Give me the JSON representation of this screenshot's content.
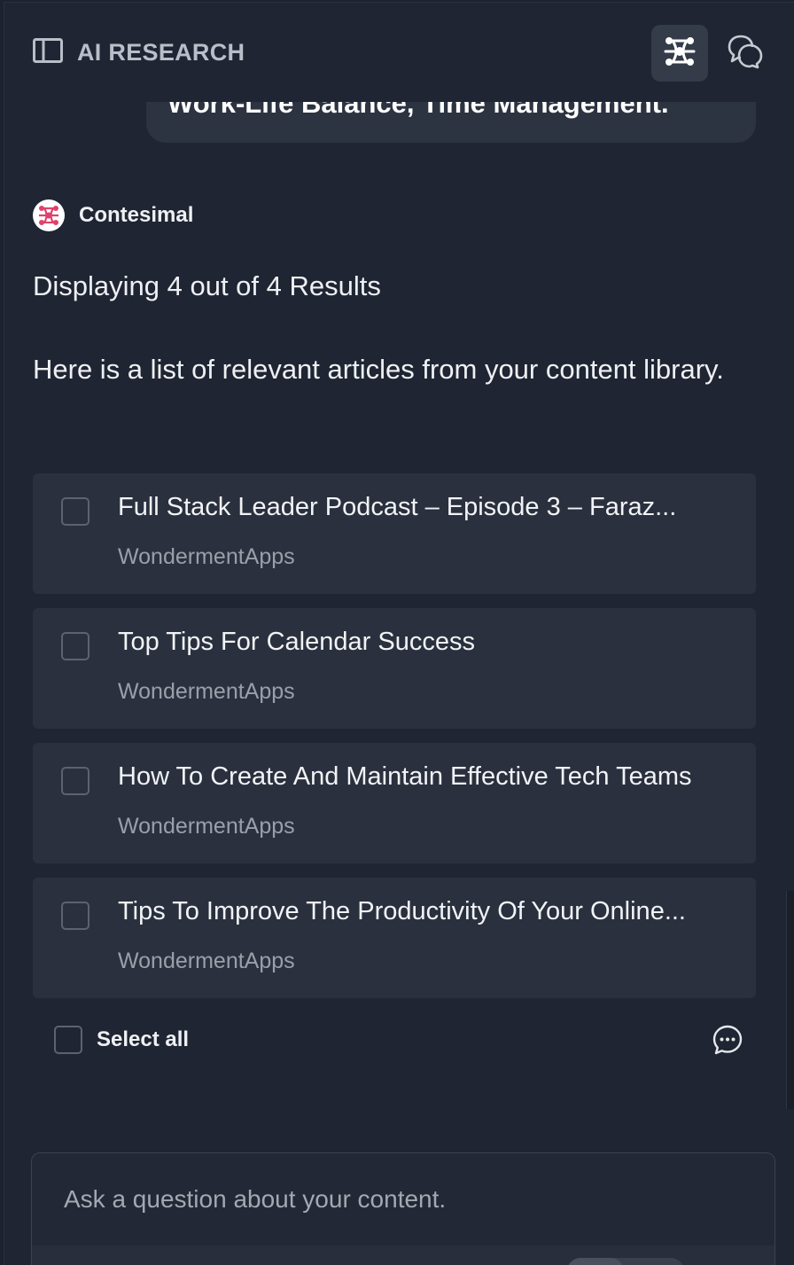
{
  "header": {
    "title": "AI RESEARCH",
    "sidebar_toggle_icon": "sidebar-panel-icon",
    "active_button_icon": "nodes-icon",
    "chat_button_icon": "chat-bubbles-icon"
  },
  "user_message": {
    "text": "Work-Life Balance, Time Management."
  },
  "assistant": {
    "name": "Contesimal",
    "logo_color": "#e0406a"
  },
  "results": {
    "count_text": "Displaying 4 out of 4 Results",
    "intro_text": "Here is a list of relevant articles from your content library.",
    "items": [
      {
        "title": "Full Stack Leader Podcast – Episode 3 – Faraz...",
        "source": "WondermentApps",
        "checked": false
      },
      {
        "title": "Top Tips For Calendar Success",
        "source": "WondermentApps",
        "checked": false
      },
      {
        "title": "How To Create And Maintain Effective Tech Teams",
        "source": "WondermentApps",
        "checked": false
      },
      {
        "title": "Tips To Improve The Productivity Of Your Online...",
        "source": "WondermentApps",
        "checked": false
      }
    ],
    "select_all_label": "Select all",
    "feedback_icon": "comment-dots-icon"
  },
  "composer": {
    "placeholder": "Ask a question about your content.",
    "value": ""
  }
}
